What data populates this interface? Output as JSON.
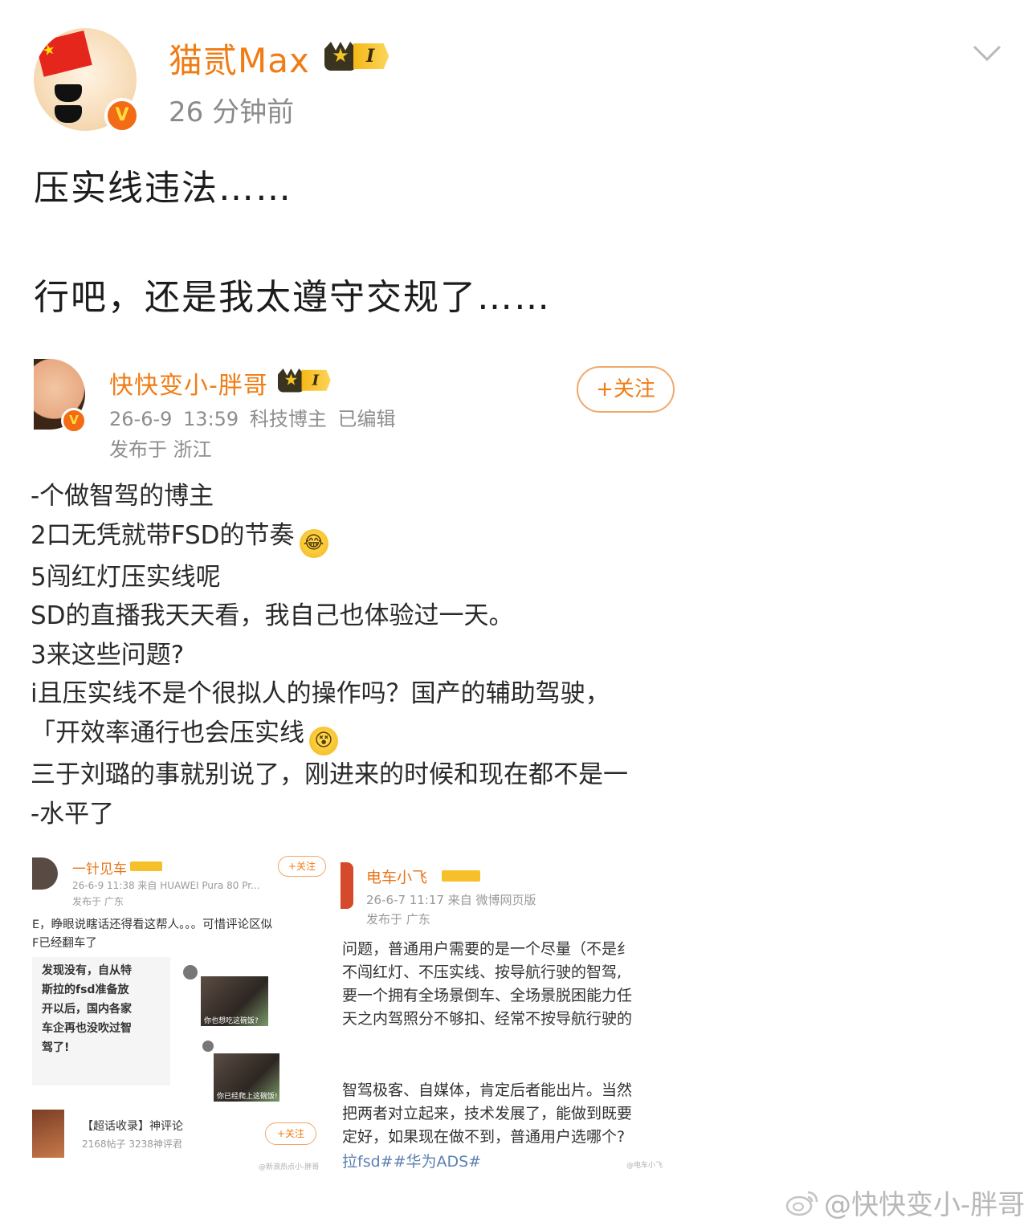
{
  "post": {
    "author": "猫贰Max",
    "level_badge": "I",
    "time": "26 分钟前",
    "text_lines": [
      "压实线违法……",
      "行吧，还是我太遵守交规了……"
    ]
  },
  "repost": {
    "author": "快快变小-胖哥",
    "level_badge": "I",
    "meta": "26-6-9 13:59  科技博主  已编辑",
    "location": "发布于 浙江",
    "follow_label": "+关注",
    "body_lines": [
      "-个做智驾的博主",
      "2口无凭就带FSD的节奏",
      "5闯红灯压实线呢",
      "SD的直播我天天看，我自己也体验过一天。",
      "3来这些问题?",
      "i且压实线不是个很拟人的操作吗？国产的辅助驾驶，",
      "「开效率通行也会压实线",
      "三于刘璐的事就别说了，刚进来的时候和现在都不是一",
      "-水平了"
    ]
  },
  "thumb_left": {
    "author": "一针见车",
    "meta": "26-6-9 11:38  来自 HUAWEI Pura 80 Pr...",
    "location": "发布于 广东",
    "follow_label": "+关注",
    "line1": "E，睁眼说瞎话还得看这帮人。。。可惜评论区似",
    "line2": "F已经翻车了",
    "card_lines": [
      "发现没有，自从特",
      "斯拉的fsd准备放",
      "开以后，国内各家",
      "车企再也没吹过智",
      "驾了!"
    ],
    "caption1": "你也想吃这碗饭?",
    "caption2": "你已经爬上这碗饭!",
    "topic_title": "【超话收录】神评论",
    "topic_meta": "2168帖子 3238神评君",
    "topic_follow": "+关注",
    "source": "@新浪热点小-胖哥"
  },
  "thumb_right": {
    "author": "电车小飞",
    "meta": "26-6-7 11:17  来自 微博网页版",
    "location": "发布于 广东",
    "para1": [
      "问题，普通用户需要的是一个尽量（不是纟",
      "不闯红灯、不压实线、按导航行驶的智驾,",
      "要一个拥有全场景倒车、全场景脱困能力任",
      "天之内驾照分不够扣、经常不按导航行驶的"
    ],
    "para2": [
      "智驾极客、自媒体，肯定后者能出片。当然",
      "把两者对立起来，技术发展了，能做到既要",
      "定好，如果现在做不到，普通用户选哪个?"
    ],
    "tags": "拉fsd##华为ADS#",
    "source": "@电车小飞"
  },
  "watermark": "@快快变小-胖哥",
  "icons": [
    "china-flag-icon",
    "verified-v-icon",
    "crown-level-icon",
    "chevron-down-icon",
    "laugh-cry-emoji-icon",
    "dizzy-emoji-icon",
    "weibo-logo-icon"
  ],
  "colors": {
    "username": "#f07c14",
    "verified": "#f36b14",
    "meta": "#8b8b8b",
    "level_badge": "#f6b817"
  }
}
